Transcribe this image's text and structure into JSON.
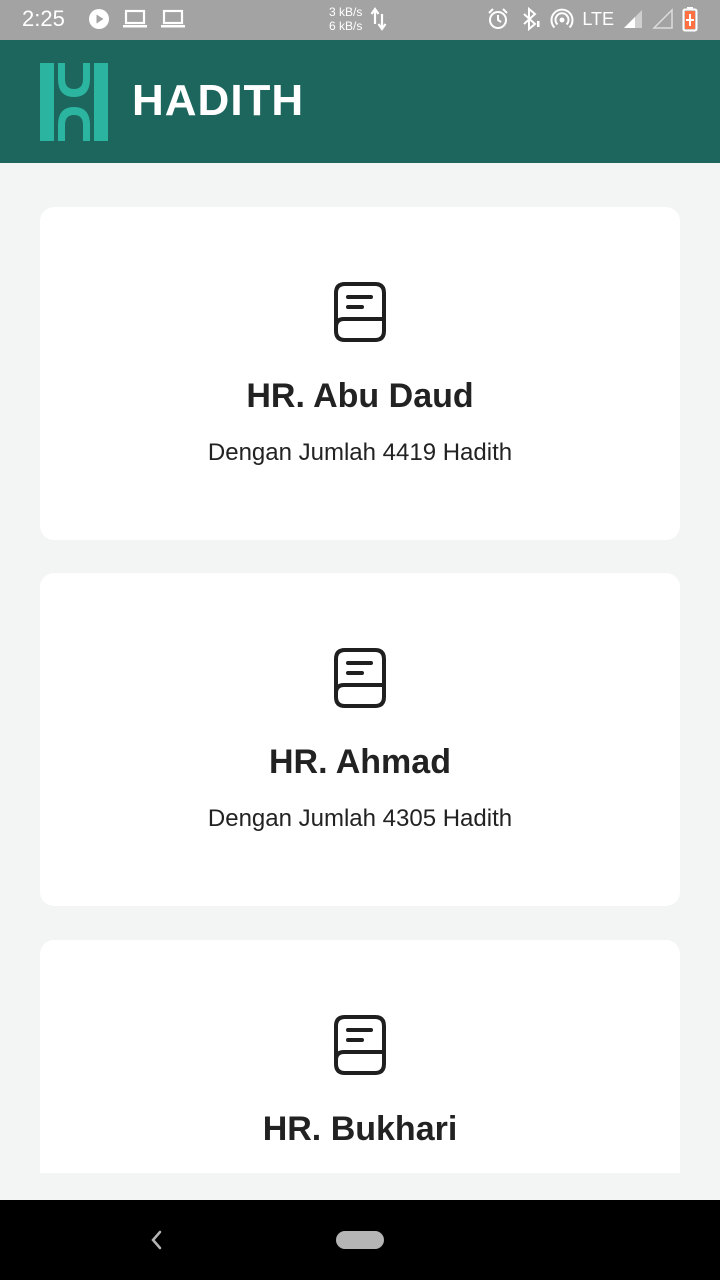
{
  "status_bar": {
    "time": "2:25",
    "speed_up": "3 kB/s",
    "speed_down": "6 kB/s",
    "network": "LTE"
  },
  "app_bar": {
    "title": "HADITH",
    "logo_color": "#2bb5a0",
    "background_color": "#1d665d"
  },
  "cards": [
    {
      "title": "HR. Abu Daud",
      "subtitle": "Dengan Jumlah 4419 Hadith",
      "icon": "book-icon"
    },
    {
      "title": "HR. Ahmad",
      "subtitle": "Dengan Jumlah 4305 Hadith",
      "icon": "book-icon"
    },
    {
      "title": "HR. Bukhari",
      "subtitle": "",
      "icon": "book-icon"
    }
  ]
}
